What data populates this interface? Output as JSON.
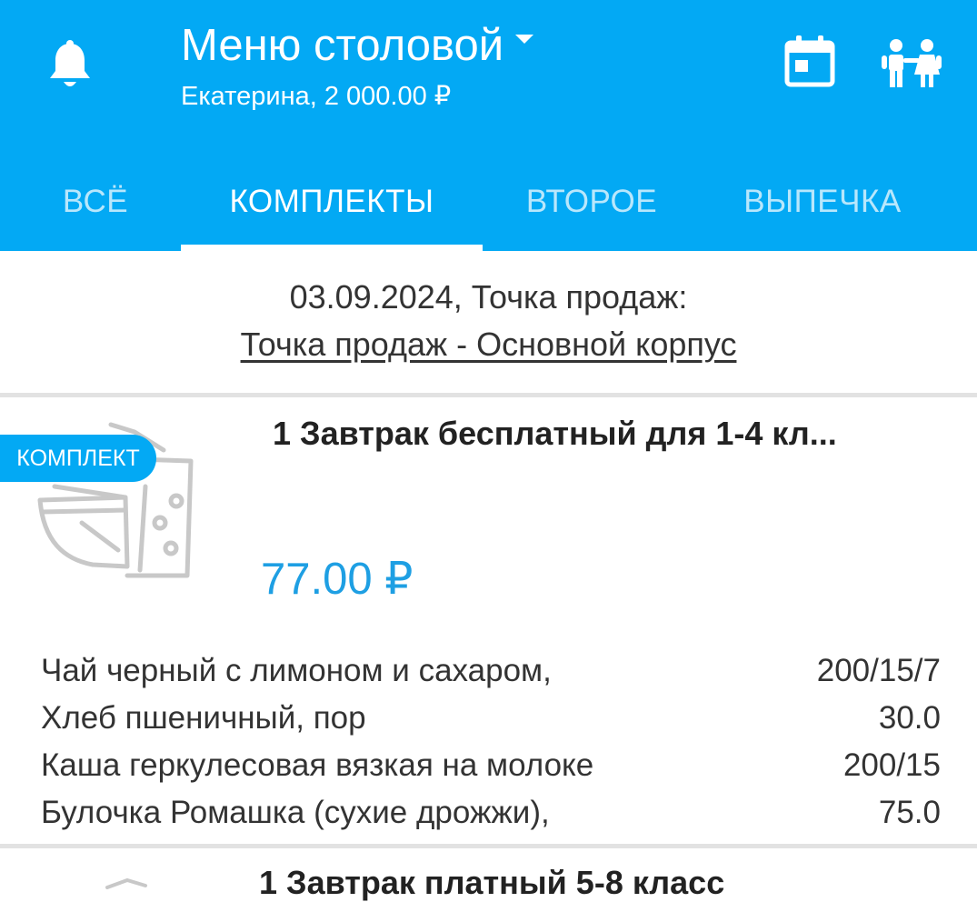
{
  "header": {
    "title": "Меню столовой",
    "subtitle": "Екатерина, 2 000.00 ₽"
  },
  "tabs": [
    {
      "label": "ВСЁ",
      "active": false
    },
    {
      "label": "КОМПЛЕКТЫ",
      "active": true
    },
    {
      "label": "ВТОРОЕ",
      "active": false
    },
    {
      "label": "ВЫПЕЧКА",
      "active": false
    }
  ],
  "date_info": {
    "date_line": "03.09.2024, Точка продаж:",
    "point_link": "Точка продаж - Основной корпус"
  },
  "items": [
    {
      "badge": "КОМПЛЕКТ",
      "title": "1 Завтрак бесплатный для 1-4 кл...",
      "price": "77.00 ₽",
      "composition": [
        {
          "name": "Чай черный с лимоном и сахаром,",
          "amount": "200/15/7"
        },
        {
          "name": "Хлеб пшеничный, пор",
          "amount": "30.0"
        },
        {
          "name": "Каша геркулесовая вязкая на молоке",
          "amount": "200/15"
        },
        {
          "name": "Булочка Ромашка (сухие дрожжи),",
          "amount": "75.0"
        }
      ]
    },
    {
      "title": "1 Завтрак платный 5-8 класс"
    }
  ],
  "colors": {
    "primary": "#03A9F4",
    "price": "#1E9FE3",
    "divider": "#E2E2E2"
  },
  "icons": [
    "bell-icon",
    "chevron-down-icon",
    "calendar-icon",
    "children-icon",
    "meal-set-icon"
  ]
}
